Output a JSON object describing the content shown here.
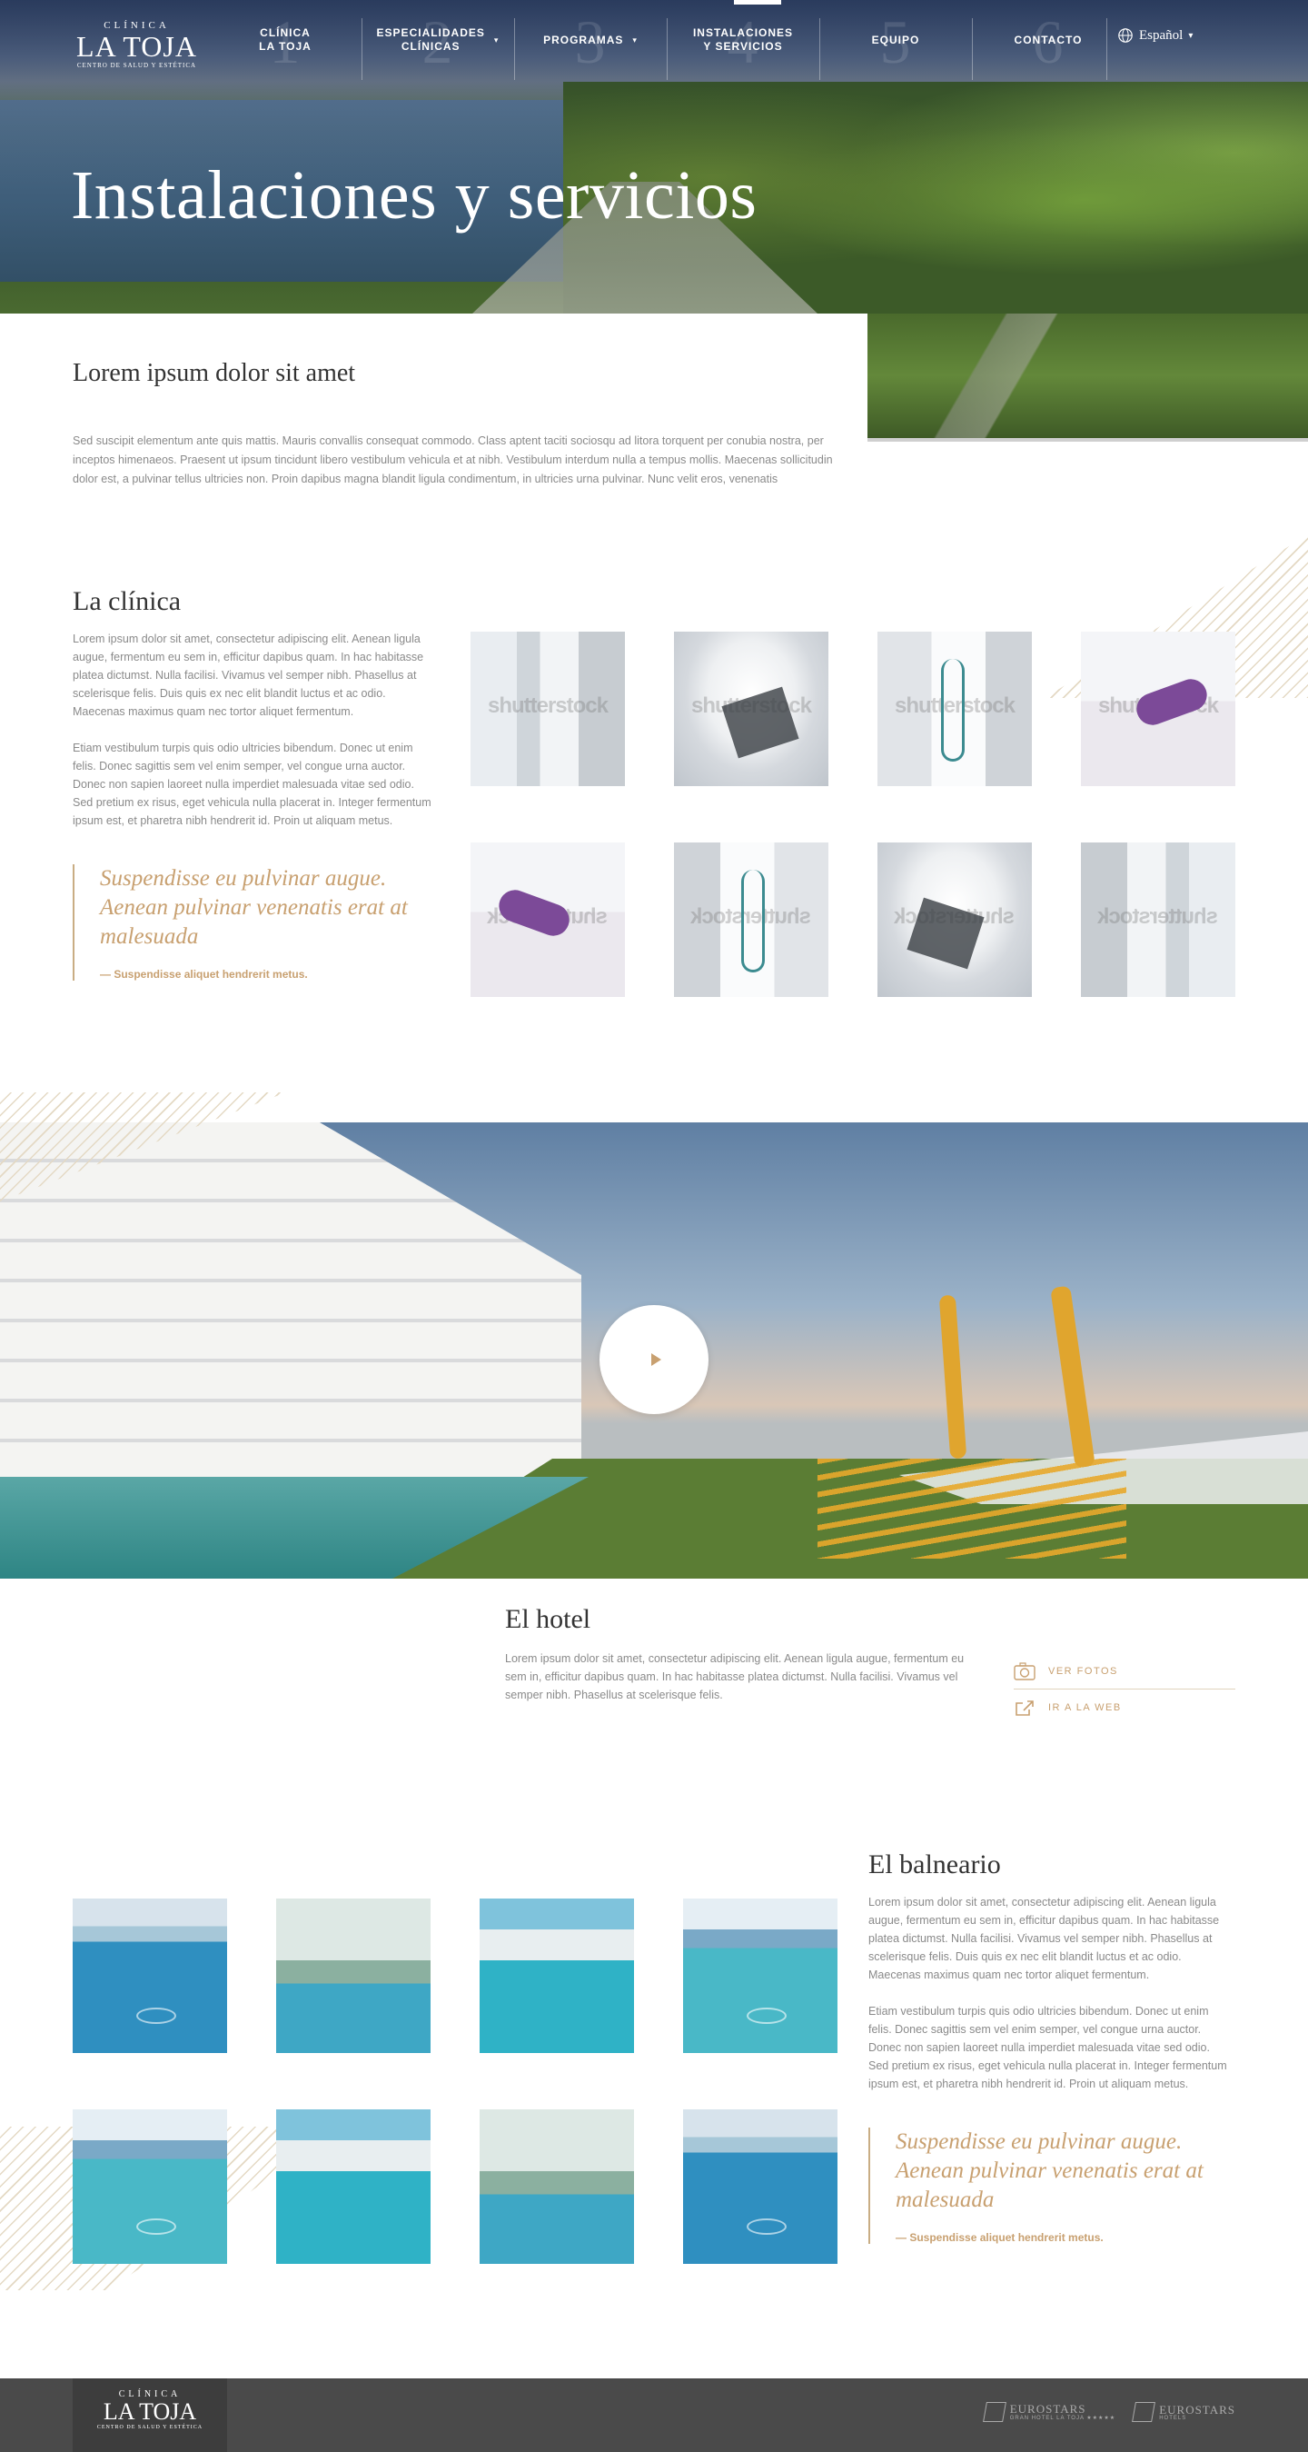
{
  "brand": {
    "line1": "CLÍNICA",
    "line2": "LA TOJA",
    "line3": "CENTRO DE SALUD Y ESTÉTICA"
  },
  "nav": {
    "items": [
      {
        "num": "1",
        "label": "CLÍNICA\nLA TOJA",
        "dropdown": false,
        "active": false
      },
      {
        "num": "2",
        "label": "ESPECIALIDADES\nCLÍNICAS",
        "dropdown": true,
        "active": false
      },
      {
        "num": "3",
        "label": "PROGRAMAS",
        "dropdown": true,
        "active": false
      },
      {
        "num": "4",
        "label": "INSTALACIONES\nY SERVICIOS",
        "dropdown": false,
        "active": true
      },
      {
        "num": "5",
        "label": "EQUIPO",
        "dropdown": false,
        "active": false
      },
      {
        "num": "6",
        "label": "CONTACTO",
        "dropdown": false,
        "active": false
      }
    ],
    "language": "Español"
  },
  "hero": {
    "title": "Instalaciones y servicios"
  },
  "intro": {
    "heading": "Lorem ipsum dolor sit amet",
    "text": "Sed suscipit elementum ante quis mattis. Mauris convallis consequat commodo. Class aptent taciti sociosqu ad litora torquent per conubia nostra, per inceptos himenaeos. Praesent ut ipsum tincidunt libero vestibulum vehicula et at nibh. Vestibulum interdum nulla a tempus mollis. Maecenas sollicitudin dolor est, a pulvinar tellus ultricies non. Proin dapibus magna blandit ligula condimentum, in ultricies urna pulvinar. Nunc velit eros, venenatis"
  },
  "clinic": {
    "heading": "La clínica",
    "p1": "Lorem ipsum dolor sit amet, consectetur adipiscing elit. Aenean ligula augue, fermentum eu sem in, efficitur dapibus quam. In hac habitasse platea dictumst. Nulla facilisi. Vivamus vel semper nibh. Phasellus at scelerisque felis. Duis quis ex nec elit blandit luctus et ac odio. Maecenas maximus quam nec tortor aliquet fermentum.",
    "p2": "Etiam vestibulum turpis quis odio ultricies bibendum. Donec ut enim felis. Donec sagittis sem vel enim semper, vel congue urna auctor. Donec non sapien laoreet nulla imperdiet malesuada vitae sed odio. Sed pretium ex risus, eget vehicula nulla placerat in. Integer fermentum ipsum est, et pharetra nibh hendrerit id. Proin ut aliquam metus.",
    "quote": "Suspendisse eu pulvinar augue. Aenean pulvinar venenatis erat at malesuada",
    "quote_source": "— Suspendisse aliquet hendrerit metus.",
    "watermark": "shutterstock"
  },
  "hotel": {
    "heading": "El hotel",
    "text": "Lorem ipsum dolor sit amet, consectetur adipiscing elit. Aenean ligula augue, fermentum eu sem in, efficitur dapibus quam. In hac habitasse platea dictumst. Nulla facilisi. Vivamus vel semper nibh. Phasellus at scelerisque felis.",
    "link_photos": "VER FOTOS",
    "link_web": "IR A LA WEB"
  },
  "spa": {
    "heading": "El balneario",
    "p1": "Lorem ipsum dolor sit amet, consectetur adipiscing elit. Aenean ligula augue, fermentum eu sem in, efficitur dapibus quam. In hac habitasse platea dictumst. Nulla facilisi. Vivamus vel semper nibh. Phasellus at scelerisque felis. Duis quis ex nec elit blandit luctus et ac odio. Maecenas maximus quam nec tortor aliquet fermentum.",
    "p2": "Etiam vestibulum turpis quis odio ultricies bibendum. Donec ut enim felis. Donec sagittis sem vel enim semper, vel congue urna auctor. Donec non sapien laoreet nulla imperdiet malesuada vitae sed odio. Sed pretium ex risus, eget vehicula nulla placerat in. Integer fermentum ipsum est, et pharetra nibh hendrerit id. Proin ut aliquam metus.",
    "quote": "Suspendisse eu pulvinar augue. Aenean pulvinar venenatis erat at malesuada",
    "quote_source": "— Suspendisse aliquet hendrerit metus."
  },
  "footer": {
    "partner1_name": "EUROSTARS",
    "partner1_sub": "GRAN HOTEL LA TOJA ★★★★★",
    "partner2_name": "EUROSTARS",
    "partner2_sub": "HOTELS"
  },
  "colors": {
    "accent": "#c8a070",
    "footer": "#4a4a4a",
    "heading": "#333333",
    "body": "#8a8a8a"
  }
}
